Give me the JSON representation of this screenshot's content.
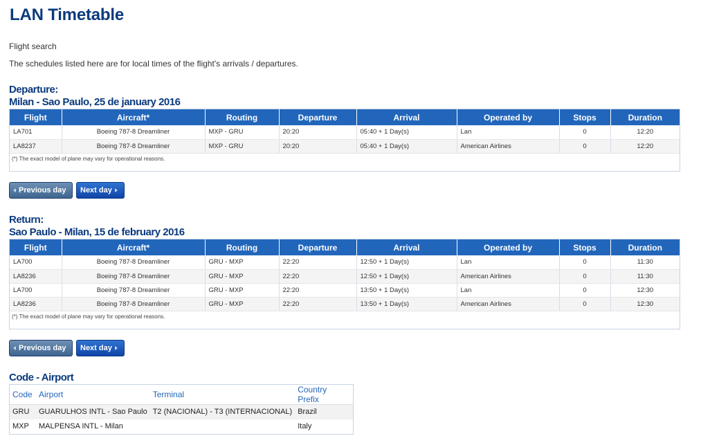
{
  "page": {
    "title": "LAN Timetable",
    "subtitle": "Flight search",
    "note": "The schedules listed here are for local times of the flight's arrivals / departures."
  },
  "columns": [
    "Flight",
    "Aircraft*",
    "Routing",
    "Departure",
    "Arrival",
    "Operated by",
    "Stops",
    "Duration"
  ],
  "departure": {
    "heading": "Departure:",
    "route_date": "Milan - Sao Paulo, 25 de january 2016",
    "rows": [
      [
        "LA701",
        "Boeing 787-8 Dreamliner",
        "MXP - GRU",
        "20:20",
        "05:40 + 1 Day(s)",
        "Lan",
        "0",
        "12:20"
      ],
      [
        "LA8237",
        "Boeing 787-8 Dreamliner",
        "MXP - GRU",
        "20:20",
        "05:40 + 1 Day(s)",
        "American Airlines",
        "0",
        "12:20"
      ]
    ],
    "footnote": "(*) The exact model of plane may vary for operational reasons."
  },
  "return": {
    "heading": "Return:",
    "route_date": "Sao Paulo - Milan, 15 de february 2016",
    "rows": [
      [
        "LA700",
        "Boeing 787-8 Dreamliner",
        "GRU - MXP",
        "22:20",
        "12:50 + 1 Day(s)",
        "Lan",
        "0",
        "11:30"
      ],
      [
        "LA8236",
        "Boeing 787-8 Dreamliner",
        "GRU - MXP",
        "22:20",
        "12:50 + 1 Day(s)",
        "American Airlines",
        "0",
        "11:30"
      ],
      [
        "LA700",
        "Boeing 787-8 Dreamliner",
        "GRU - MXP",
        "22:20",
        "13:50 + 1 Day(s)",
        "Lan",
        "0",
        "12:30"
      ],
      [
        "LA8236",
        "Boeing 787-8 Dreamliner",
        "GRU - MXP",
        "22:20",
        "13:50 + 1 Day(s)",
        "American Airlines",
        "0",
        "12:30"
      ]
    ],
    "footnote": "(*) The exact model of plane may vary for operational reasons."
  },
  "buttons": {
    "previous_day": "Previous day",
    "next_day": "Next day"
  },
  "airports": {
    "heading": "Code - Airport",
    "columns": [
      "Code",
      "Airport",
      "Terminal",
      "Country Prefix"
    ],
    "rows": [
      [
        "GRU",
        "GUARULHOS INTL - Sao Paulo",
        "T2 (NACIONAL) - T3 (INTERNACIONAL)",
        "Brazil"
      ],
      [
        "MXP",
        "MALPENSA INTL - Milan",
        "",
        "Italy"
      ]
    ]
  },
  "colors": {
    "title": "#0b3a7e",
    "header_bg": "#2266bb",
    "prev_button": "#4e75a0",
    "next_button": "#1a55b8"
  }
}
